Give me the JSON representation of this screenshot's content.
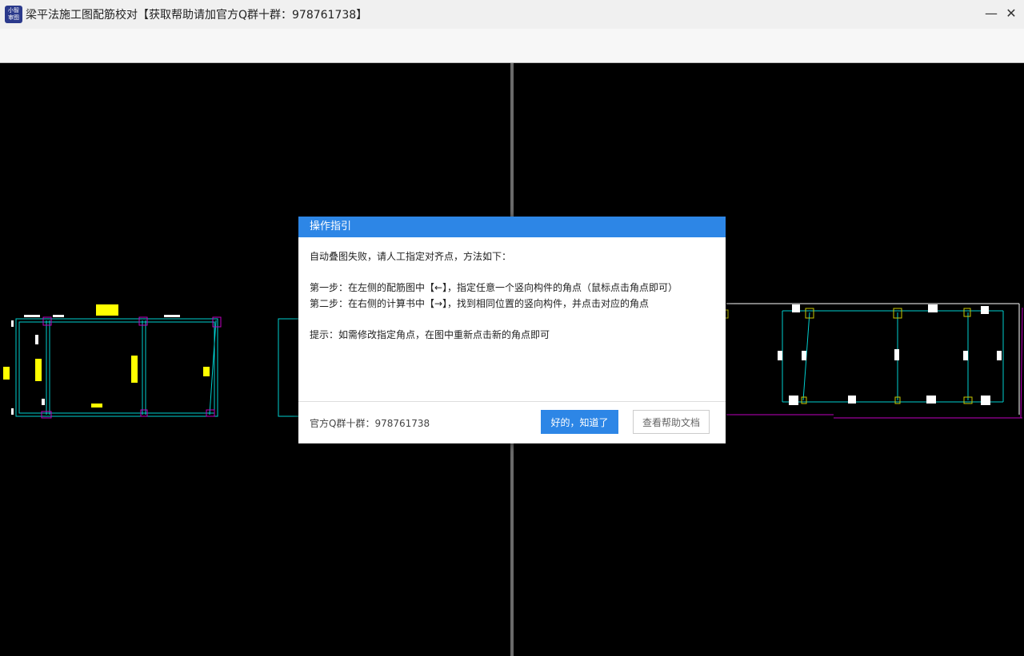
{
  "window": {
    "icon_text": "小智\n审图",
    "title": "梁平法施工图配筋校对【获取帮助请加官方Q群十群：978761738】",
    "minimize_glyph": "—",
    "close_glyph": "✕"
  },
  "dialog": {
    "title": "操作指引",
    "line1": "自动叠图失败，请人工指定对齐点，方法如下：",
    "step1": "第一步：在左侧的配筋图中【←】，指定任意一个竖向构件的角点（鼠标点击角点即可）",
    "step2": "第二步：在右侧的计算书中【→】，找到相同位置的竖向构件，并点击对应的角点",
    "tip": "提示：如需修改指定角点，在图中重新点击新的角点即可",
    "qq_group": "官方Q群十群：978761738",
    "ok_label": "好的，知道了",
    "help_label": "查看帮助文档"
  },
  "colors": {
    "accent": "#2d86e6",
    "canvas": "#000000",
    "beam_line": "#00d0d0",
    "column": "#c000c0",
    "annotation": "#ffff00"
  }
}
